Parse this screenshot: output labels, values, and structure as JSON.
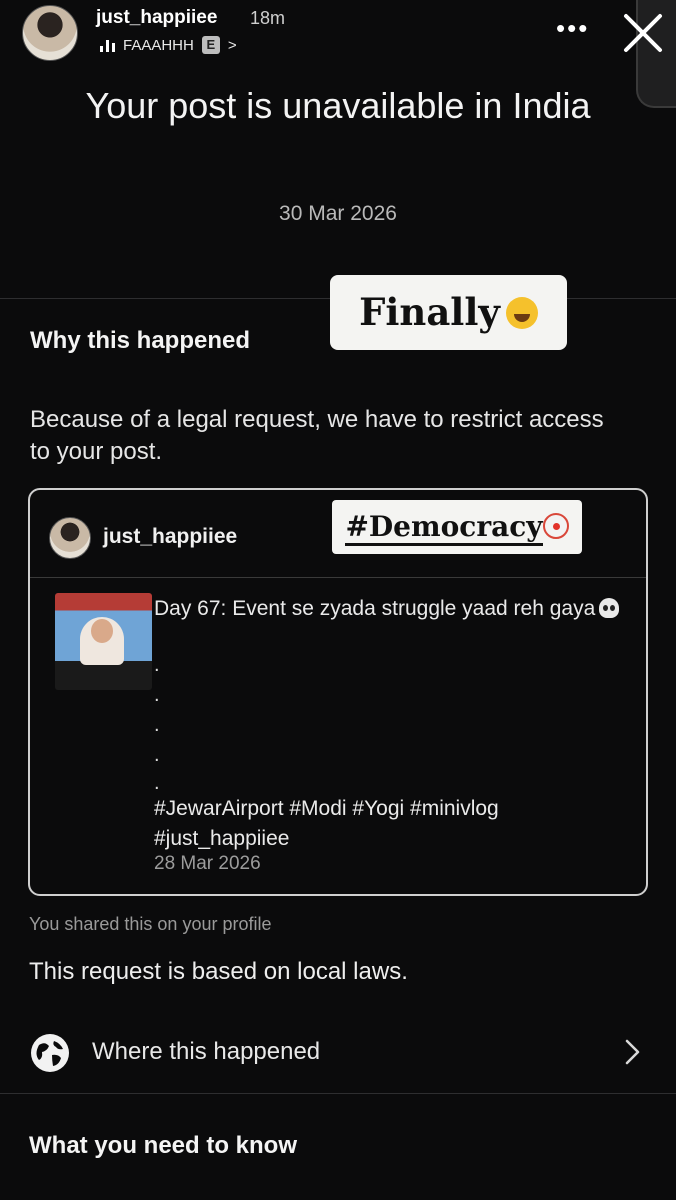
{
  "story": {
    "username": "just_happiiee",
    "time": "18m",
    "music_title": "FAAAHHH",
    "explicit_badge": "E",
    "music_chevron": ">"
  },
  "notice": {
    "title": "Your post is unavailable in India",
    "date": "30 Mar 2026",
    "why_heading": "Why this happened",
    "reason": "Because of a legal request, we have to restrict access to your post."
  },
  "stickers": {
    "finally": "Finally",
    "democracy": "#Democracy"
  },
  "post": {
    "username": "just_happiiee",
    "caption": "Day 67: Event se zyada struggle yaad reh gaya",
    "dots": [
      ".",
      ".",
      ".",
      ".",
      "."
    ],
    "hashtags": "#JewarAirport #Modi #Yogi #minivlog #just_happiiee",
    "date": "28 Mar 2026"
  },
  "footer": {
    "shared_note": "You shared this on your profile",
    "laws_note": "This request is based on local laws.",
    "where_label": "Where this happened",
    "need_to_know": "What you need to know"
  },
  "colors": {
    "background": "#0b0b0c",
    "sticker_bg": "#f4f4f2",
    "card_border": "#cfcfcf"
  }
}
